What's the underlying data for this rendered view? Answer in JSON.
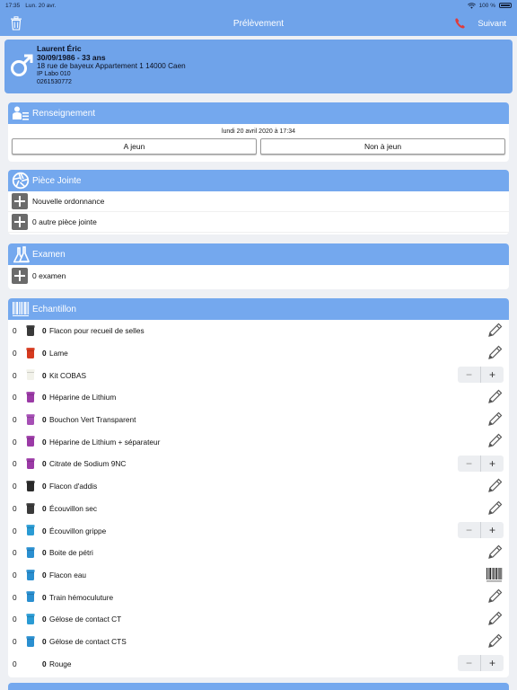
{
  "status": {
    "time": "17:35",
    "date": "Lun. 20 avr.",
    "battery": "100 %"
  },
  "nav": {
    "title": "Prélèvement",
    "next_label": "Suivant"
  },
  "patient": {
    "name": "Laurent Éric",
    "dob_age": "30/09/1986 - 33 ans",
    "address": "18 rue de bayeux Appartement 1 14000 Caen",
    "ip": "IP Labo 010",
    "phone": "0261530772"
  },
  "renseignement": {
    "title": "Renseignement",
    "datetime": "lundi 20 avril 2020 à 17:34",
    "option_a": "A jeun",
    "option_b": "Non à jeun"
  },
  "piece_jointe": {
    "title": "Pièce Jointe",
    "items": [
      "Nouvelle ordonnance",
      "0 autre pièce jointe"
    ]
  },
  "examen": {
    "title": "Examen",
    "items": [
      "0 examen"
    ]
  },
  "echantillon": {
    "title": "Echantillon",
    "stepper_minus": "−",
    "stepper_plus": "+",
    "rows": [
      {
        "qty": "0",
        "count": "0",
        "label": "Flacon pour recueil de selles",
        "tube_color": "#3a3a3a",
        "action": "pencil"
      },
      {
        "qty": "0",
        "count": "0",
        "label": "Lame",
        "tube_color": "#d63a1f",
        "action": "pencil"
      },
      {
        "qty": "0",
        "count": "0",
        "label": "Kit COBAS",
        "tube_color": "#f2f2ea",
        "action": "stepper"
      },
      {
        "qty": "0",
        "count": "0",
        "label": "Héparine de Lithium",
        "tube_color": "#9b3aa6",
        "action": "pencil"
      },
      {
        "qty": "0",
        "count": "0",
        "label": "Bouchon Vert Transparent",
        "tube_color": "#a64fb5",
        "action": "pencil"
      },
      {
        "qty": "0",
        "count": "0",
        "label": "Héparine de Lithium + séparateur",
        "tube_color": "#9b3aa6",
        "action": "pencil"
      },
      {
        "qty": "0",
        "count": "0",
        "label": "Citrate de Sodium 9NC",
        "tube_color": "#9b3aa6",
        "action": "stepper"
      },
      {
        "qty": "0",
        "count": "0",
        "label": "Flacon d'addis",
        "tube_color": "#2b2b2b",
        "action": "pencil"
      },
      {
        "qty": "0",
        "count": "0",
        "label": "Écouvillon sec",
        "tube_color": "#3a3a3a",
        "action": "pencil"
      },
      {
        "qty": "0",
        "count": "0",
        "label": "Écouvillon grippe",
        "tube_color": "#2a9bd4",
        "action": "stepper"
      },
      {
        "qty": "0",
        "count": "0",
        "label": "Boite de pétri",
        "tube_color": "#2a8fd0",
        "action": "pencil"
      },
      {
        "qty": "0",
        "count": "0",
        "label": "Flacon eau",
        "tube_color": "#2a8fd0",
        "action": "barcode"
      },
      {
        "qty": "0",
        "count": "0",
        "label": "Train hémoculuture",
        "tube_color": "#2a8fd0",
        "action": "pencil"
      },
      {
        "qty": "0",
        "count": "0",
        "label": "Gélose de contact CT",
        "tube_color": "#2a9bd4",
        "action": "pencil"
      },
      {
        "qty": "0",
        "count": "0",
        "label": "Gélose de contact CTS",
        "tube_color": "#2a8fd0",
        "action": "pencil"
      },
      {
        "qty": "0",
        "count": "0",
        "label": "Rouge",
        "tube_color": "",
        "action": "stepper"
      }
    ]
  }
}
